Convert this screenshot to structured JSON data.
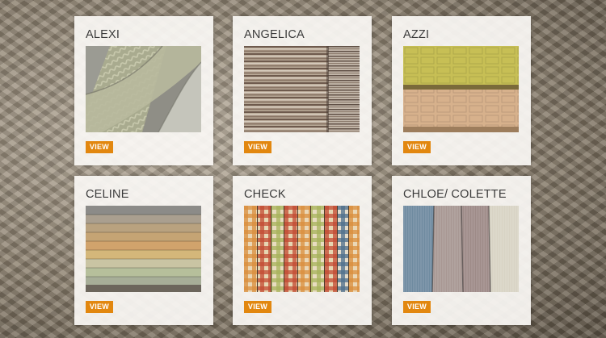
{
  "products": [
    {
      "name": "ALEXI",
      "button": "VIEW",
      "swatch": "herringbone-fabric"
    },
    {
      "name": "ANGELICA",
      "button": "VIEW",
      "swatch": "striped-fabric"
    },
    {
      "name": "AZZI",
      "button": "VIEW",
      "swatch": "jacquard-fabric"
    },
    {
      "name": "CELINE",
      "button": "VIEW",
      "swatch": "stacked-linen-fabric"
    },
    {
      "name": "CHECK",
      "button": "VIEW",
      "swatch": "checked-fabric"
    },
    {
      "name": "CHLOE/ COLETTE",
      "button": "VIEW",
      "swatch": "draped-stripe-fabric"
    }
  ],
  "colors": {
    "button_bg": "#e2870f",
    "button_text": "#ffffff",
    "card_bg": "#faf8f4",
    "title_text": "#3b3b3b"
  }
}
